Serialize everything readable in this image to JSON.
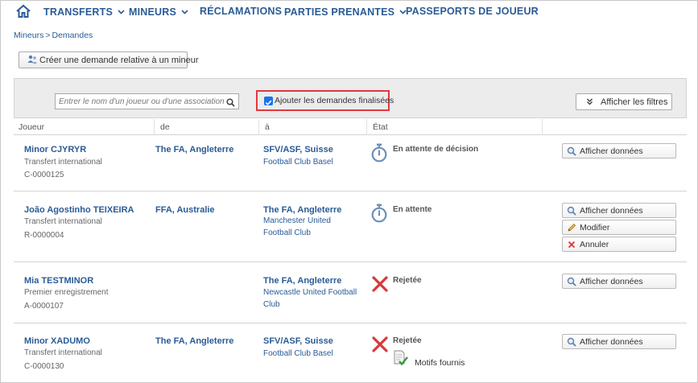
{
  "nav": {
    "items": [
      "TRANSFERTS",
      "MINEURS",
      "RÉCLAMATIONS",
      "PARTIES PRENANTES",
      "PASSEPORTS DE JOUEUR"
    ]
  },
  "breadcrumb": {
    "parent": "Mineurs",
    "separator": ">",
    "current": "Demandes"
  },
  "toolbar": {
    "create_label": "Créer une demande relative à un mineur"
  },
  "filters": {
    "search_placeholder": "Entrer le nom d'un joueur ou d'une association",
    "include_finalized_label": "Ajouter les demandes finalisées",
    "include_finalized_checked": true,
    "show_filters_label": "Afficher les filtres"
  },
  "table": {
    "headers": [
      "Joueur",
      "de",
      "à",
      "État"
    ],
    "rows": [
      {
        "player": "Minor CJYRYR",
        "type": "Transfert international",
        "ref": "C-0000125",
        "from": "The FA, Angleterre",
        "to": "SFV/ASF, Suisse",
        "to_club": [
          "Football Club Basel"
        ],
        "state": "En attente de décision",
        "state_icon": "stopwatch-icon",
        "actions": [
          "Afficher données"
        ]
      },
      {
        "player": "João Agostinho TEIXEIRA",
        "type": "Transfert international",
        "ref": "R-0000004",
        "from": "FFA, Australie",
        "to": "The FA, Angleterre",
        "to_club": [
          "Manchester United",
          "Football Club"
        ],
        "state": "En attente",
        "state_icon": "stopwatch-icon",
        "actions": [
          "Afficher données",
          "Modifier",
          "Annuler"
        ]
      },
      {
        "player": "Mia TESTMINOR",
        "type": "Premier enregistrement",
        "ref": "A-0000107",
        "from": "",
        "to": "The FA, Angleterre",
        "to_club": [
          "Newcastle United Football",
          "Club"
        ],
        "state": "Rejetée",
        "state_icon": "red-x-icon",
        "actions": [
          "Afficher données"
        ]
      },
      {
        "player": "Minor XADUMO",
        "type": "Transfert international",
        "ref": "C-0000130",
        "from": "The FA, Angleterre",
        "to": "SFV/ASF, Suisse",
        "to_club": [
          "Football Club Basel"
        ],
        "state": "Rejetée",
        "state_icon": "red-x-icon",
        "extra": "Motifs fournis",
        "actions": [
          "Afficher données"
        ]
      }
    ]
  },
  "colors": {
    "link_blue": "#2a5b96",
    "highlight_red": "#e0393e",
    "checkbox_blue": "#1a73e8"
  }
}
